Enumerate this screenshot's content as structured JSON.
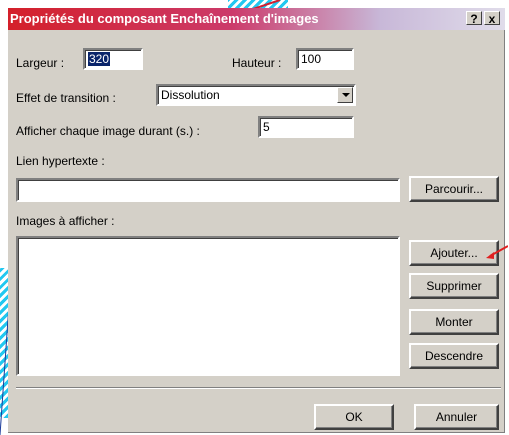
{
  "window": {
    "title": "Propriétés du composant Enchaînement d'images",
    "help_label": "?",
    "close_label": "x",
    "title_gradient_start": "#d4202a"
  },
  "form": {
    "largeur_label": "Largeur :",
    "largeur_value": "320",
    "hauteur_label": "Hauteur :",
    "hauteur_value": "100",
    "effet_label": "Effet de transition :",
    "effet_value": "Dissolution",
    "duree_label": "Afficher chaque image durant (s.) :",
    "duree_value": "5",
    "lien_label": "Lien hypertexte :",
    "lien_value": "",
    "parcourir_label": "Parcourir...",
    "images_label": "Images à afficher :",
    "images_list": []
  },
  "list_buttons": {
    "ajouter": "Ajouter...",
    "supprimer": "Supprimer",
    "monter": "Monter",
    "descendre": "Descendre"
  },
  "footer": {
    "ok": "OK",
    "annuler": "Annuler"
  },
  "colors": {
    "dialog_bg": "#d4d0c8",
    "selection": "#0a246a",
    "annotation_arrow": "#e02020",
    "stripes": "#22c8f0"
  }
}
